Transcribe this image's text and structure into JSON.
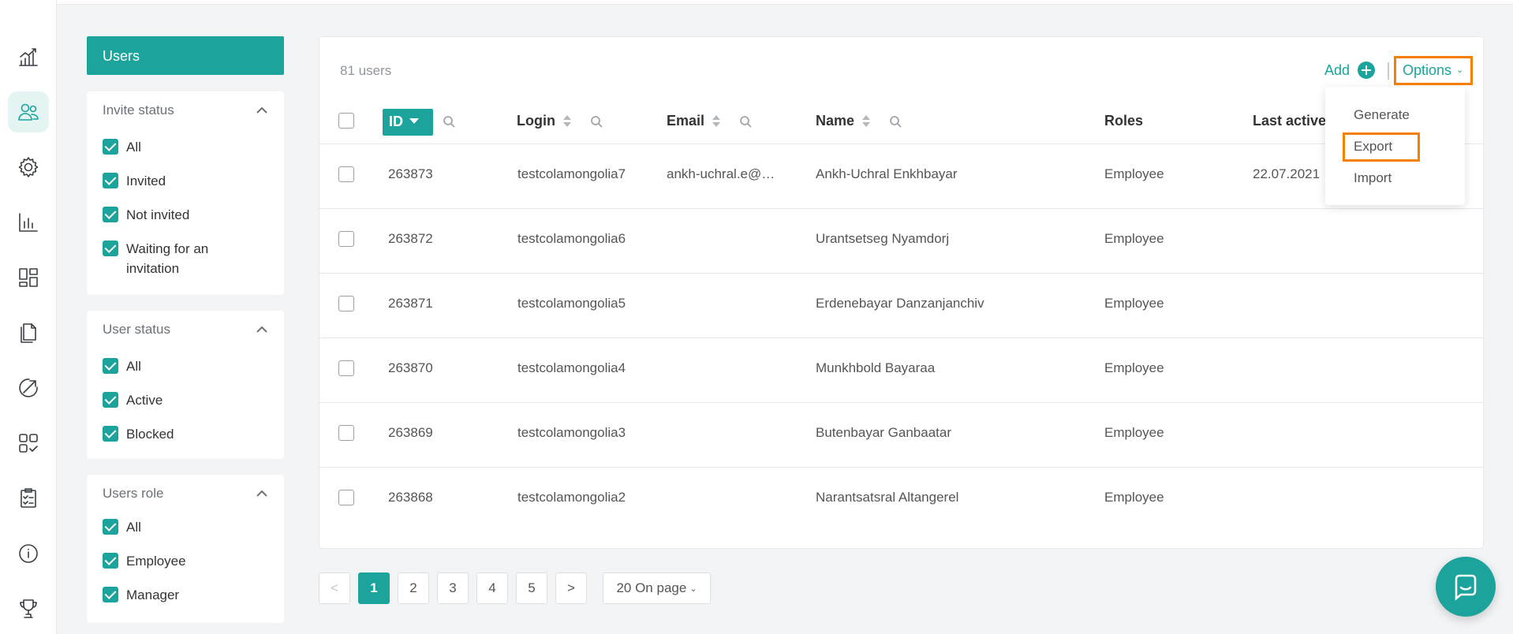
{
  "rail": {
    "items": [
      {
        "icon": "growth-chart-icon",
        "active": false
      },
      {
        "icon": "users-icon",
        "active": true
      },
      {
        "icon": "gear-icon",
        "active": false
      },
      {
        "icon": "bar-chart-icon",
        "active": false
      },
      {
        "icon": "dashboard-icon",
        "active": false
      },
      {
        "icon": "documents-icon",
        "active": false
      },
      {
        "icon": "arrow-up-right-icon",
        "active": false
      },
      {
        "icon": "apps-check-icon",
        "active": false
      },
      {
        "icon": "checklist-icon",
        "active": false
      },
      {
        "icon": "info-icon",
        "active": false
      },
      {
        "icon": "trophy-icon",
        "active": false
      }
    ]
  },
  "sidebar": {
    "users_tab": "Users",
    "invite_status": {
      "title": "Invite status",
      "options": [
        "All",
        "Invited",
        "Not invited",
        "Waiting for an invitation"
      ]
    },
    "user_status": {
      "title": "User status",
      "options": [
        "All",
        "Active",
        "Blocked"
      ]
    },
    "users_role": {
      "title": "Users role",
      "options": [
        "All",
        "Employee",
        "Manager"
      ]
    }
  },
  "toolbar": {
    "count": "81 users",
    "add_label": "Add",
    "options_label": "Options"
  },
  "table": {
    "columns": [
      "ID",
      "Login",
      "Email",
      "Name",
      "Roles",
      "Last active"
    ],
    "rows": [
      {
        "id": "263873",
        "login": "testcolamongolia7",
        "email": "ankh-uchral.e@…",
        "name": "Ankh-Uchral Enkhbayar",
        "role": "Employee",
        "last_active": "22.07.2021"
      },
      {
        "id": "263872",
        "login": "testcolamongolia6",
        "email": "",
        "name": "Urantsetseg Nyamdorj",
        "role": "Employee",
        "last_active": ""
      },
      {
        "id": "263871",
        "login": "testcolamongolia5",
        "email": "",
        "name": "Erdenebayar Danzanjanchiv",
        "role": "Employee",
        "last_active": ""
      },
      {
        "id": "263870",
        "login": "testcolamongolia4",
        "email": "",
        "name": "Munkhbold Bayaraa",
        "role": "Employee",
        "last_active": ""
      },
      {
        "id": "263869",
        "login": "testcolamongolia3",
        "email": "",
        "name": "Butenbayar Ganbaatar",
        "role": "Employee",
        "last_active": ""
      },
      {
        "id": "263868",
        "login": "testcolamongolia2",
        "email": "",
        "name": "Narantsatsral Altangerel",
        "role": "Employee",
        "last_active": ""
      }
    ]
  },
  "options_menu": {
    "items": [
      "Generate",
      "Export",
      "Import"
    ]
  },
  "pagination": {
    "prev": "<",
    "pages": [
      "1",
      "2",
      "3",
      "4",
      "5"
    ],
    "current": "1",
    "next": ">",
    "per_page": "20 On page"
  },
  "colors": {
    "accent": "#1ba39c",
    "highlight": "#f77f00"
  }
}
